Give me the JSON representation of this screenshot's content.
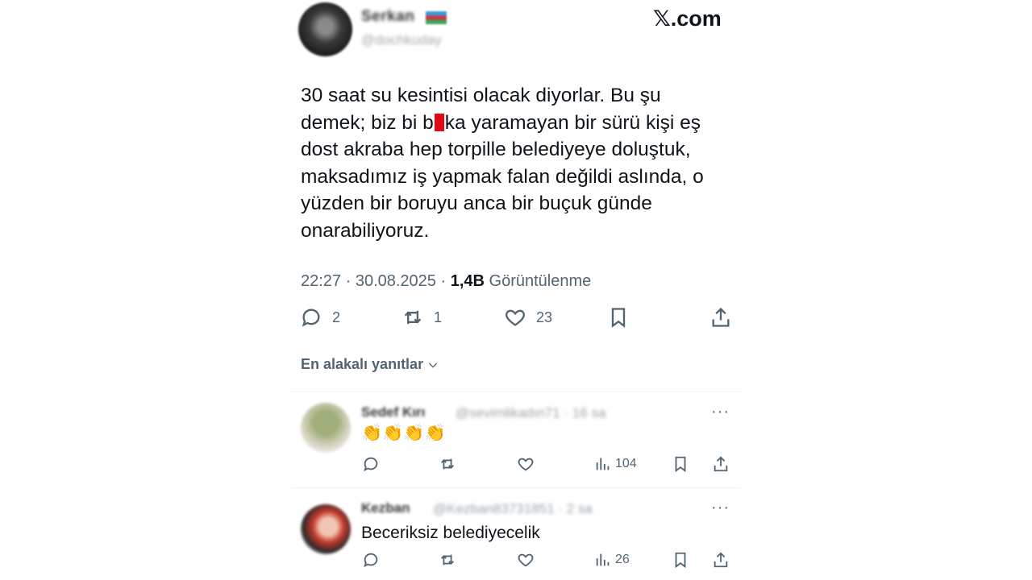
{
  "header": {
    "display_name": "Serkan",
    "handle": "@dochkuday",
    "brand": "𝕏.com"
  },
  "tweet": {
    "text_before": "30 saat su kesintisi olacak diyorlar. Bu şu\ndemek; biz bi b",
    "text_after": "ka yaramayan bir sürü kişi eş\ndost akraba hep torpille belediyeye doluştuk,\nmaksadımız iş yapmak falan değildi aslında, o\nyüzden bir boruyu anca bir buçuk günde\nonarabiliyoruz.",
    "time": "22:27 · 30.08.2025 · ",
    "views_count": "1,4B",
    "views_label": "Görüntülenme"
  },
  "actions": {
    "replies": "2",
    "reposts": "1",
    "likes": "23"
  },
  "sort": {
    "label": "En alakalı yanıtlar"
  },
  "replies": [
    {
      "name": "Sedef Kırı",
      "handle": "@sevimlikadın71 · 16 sa",
      "text": "👏👏👏👏",
      "views": "104"
    },
    {
      "name": "Kezban",
      "handle": "@Kezban83731851 · 2 sa",
      "text": "Beceriksiz belediyecelik",
      "views": "26"
    }
  ],
  "colors": {
    "text": "#0f1419",
    "muted": "#536471",
    "censor": "#e30613",
    "divider": "#eff3f4"
  }
}
